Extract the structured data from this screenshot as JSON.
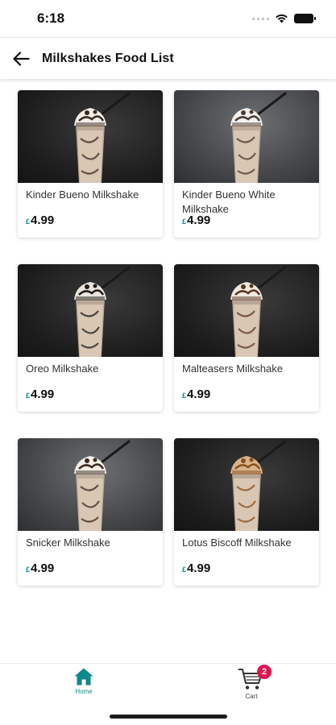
{
  "status_bar": {
    "time": "6:18"
  },
  "header": {
    "title": "Milkshakes Food List"
  },
  "items": [
    {
      "name": "Kinder Bueno Milkshake",
      "currency": "£",
      "price": "4.99",
      "bg": "dark",
      "topping": "#f2ede6",
      "drizzle": "#3a2a22"
    },
    {
      "name": "Kinder Bueno White Milkshake",
      "currency": "£",
      "price": "4.99",
      "bg": "gray",
      "topping": "#f4f1ec",
      "drizzle": "#4a3a30"
    },
    {
      "name": "Oreo Milkshake",
      "currency": "£",
      "price": "4.99",
      "bg": "dark",
      "topping": "#e9e4dd",
      "drizzle": "#1e1a18"
    },
    {
      "name": "Malteasers Milkshake",
      "currency": "£",
      "price": "4.99",
      "bg": "dark",
      "topping": "#efe9e1",
      "drizzle": "#5a3520"
    },
    {
      "name": "Snicker Milkshake",
      "currency": "£",
      "price": "4.99",
      "bg": "gray",
      "topping": "#f2eee8",
      "drizzle": "#3c2a20"
    },
    {
      "name": "Lotus Biscoff Milkshake",
      "currency": "£",
      "price": "4.99",
      "bg": "dark",
      "topping": "#d9b48a",
      "drizzle": "#8a4e1c"
    }
  ],
  "nav": {
    "home_label": "Home",
    "cart_label": "Cart",
    "cart_count": "2",
    "accent": "#0f8a8a",
    "badge_color": "#e0144f"
  }
}
